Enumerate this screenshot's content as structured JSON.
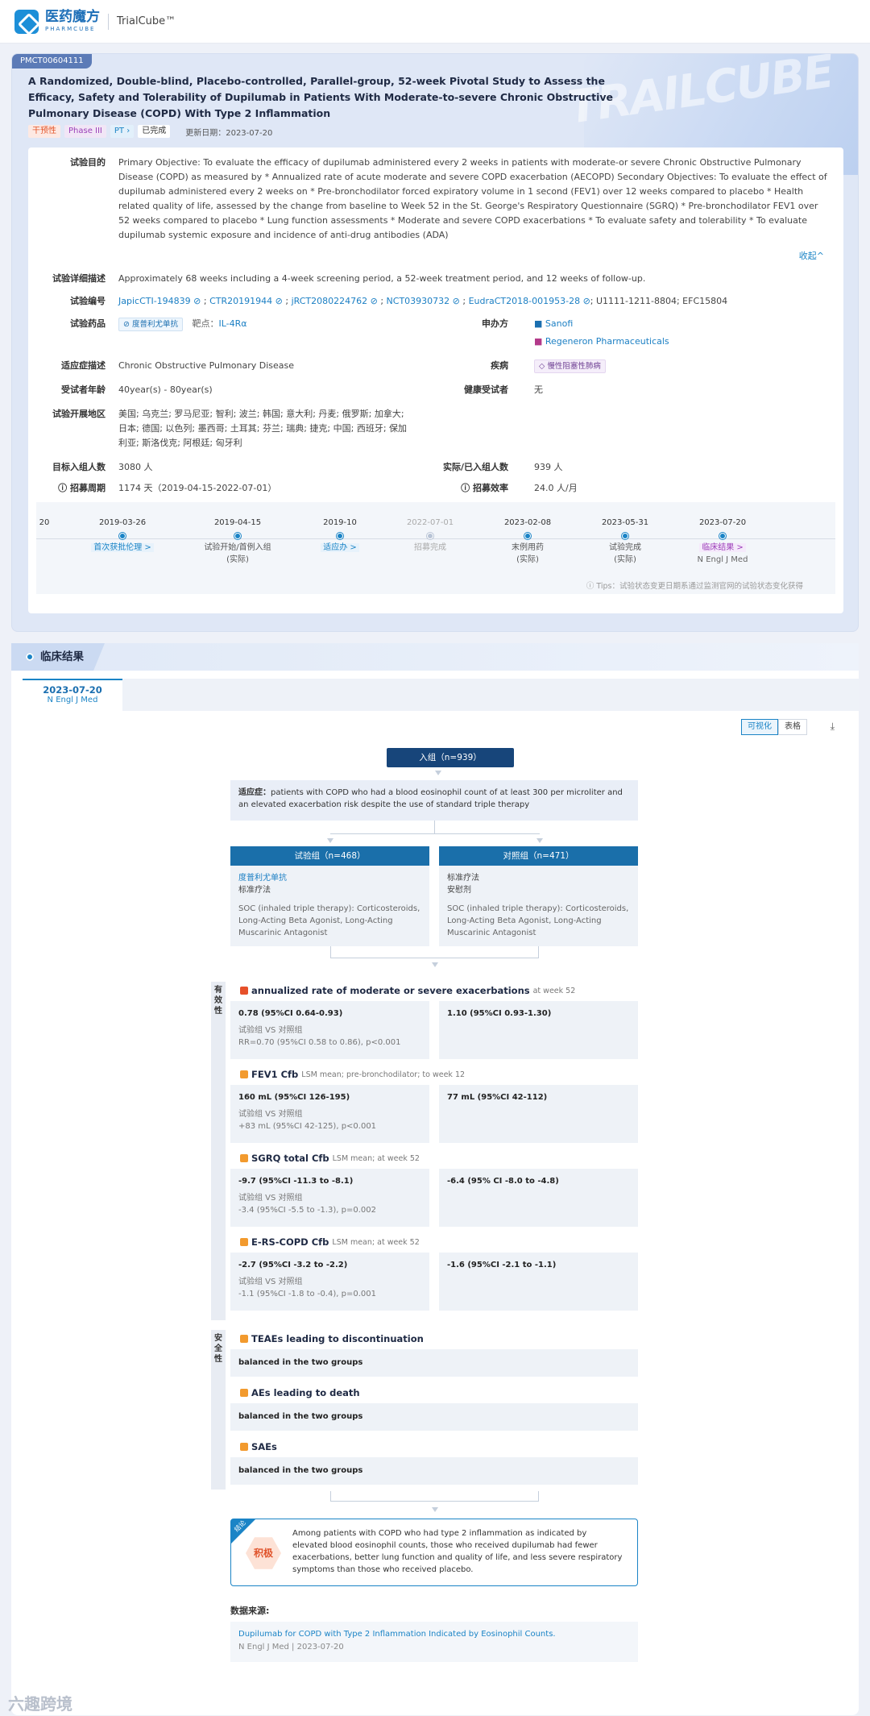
{
  "topbar": {
    "brand_cn": "医药魔方",
    "brand_en": "PHARMCUBE",
    "product": "TrialCube™"
  },
  "trial": {
    "id": "PMCT00604111",
    "title": "A Randomized, Double-blind, Placebo-controlled, Parallel-group, 52-week Pivotal Study to Assess the Efficacy, Safety and Tolerability of Dupilumab in Patients With Moderate-to-severe Chronic Obstructive Pulmonary Disease (COPD) With Type 2 Inflammation",
    "tags": [
      "干预性",
      "Phase III",
      "PT",
      "已完成"
    ],
    "updated_label": "更新日期：",
    "updated": "2023-07-20",
    "deco_text": "TRAILCUBE"
  },
  "fields": {
    "purpose_label": "试验目的",
    "purpose": "Primary Objective: To evaluate the efficacy of dupilumab administered every 2 weeks in patients with moderate-or severe Chronic Obstructive Pulmonary Disease (COPD) as measured by * Annualized rate of acute moderate and severe COPD exacerbation (AECOPD) Secondary Objectives: To evaluate the effect of dupilumab administered every 2 weeks on * Pre-bronchodilator forced expiratory volume in 1 second (FEV1) over 12 weeks compared to placebo * Health related quality of life, assessed by the change from baseline to Week 52 in the St. George's Respiratory Questionnaire (SGRQ) * Pre-bronchodilator FEV1 over 52 weeks compared to placebo * Lung function assessments * Moderate and severe COPD exacerbations * To evaluate safety and tolerability * To evaluate dupilumab systemic exposure and incidence of anti-drug antibodies (ADA)",
    "collapse": "收起^",
    "detail_label": "试验详细描述",
    "detail": "Approximately 68 weeks including a 4-week screening period, a 52-week treatment period, and 12 weeks of follow-up.",
    "ids_label": "试验编号",
    "ids": [
      "JapicCTI-194839",
      "CTR20191944",
      "jRCT2080224762",
      "NCT03930732",
      "EudraCT2018-001953-28"
    ],
    "ids_tail": "; U1111-1211-8804; EFC15804",
    "drug_label": "试验药品",
    "drug": "度普利尤单抗",
    "target_label": "靶点：",
    "target": "IL-4Rα",
    "sponsor_label": "申办方",
    "sponsors": [
      "Sanofi",
      "Regeneron Pharmaceuticals"
    ],
    "indication_label": "适应症描述",
    "indication": "Chronic Obstructive Pulmonary Disease",
    "disease_label": "疾病",
    "disease": "慢性阻塞性肺病",
    "age_label": "受试者年龄",
    "age": "40year(s) - 80year(s)",
    "healthy_label": "健康受试者",
    "healthy": "无",
    "region_label": "试验开展地区",
    "region": "美国; 乌克兰; 罗马尼亚; 智利; 波兰; 韩国; 意大利; 丹麦; 俄罗斯; 加拿大; 日本; 德国; 以色列; 墨西哥; 土耳其; 芬兰; 瑞典; 捷克; 中国; 西班牙; 保加利亚; 斯洛伐克; 阿根廷; 匈牙利",
    "target_enroll_label": "目标入组人数",
    "target_enroll": "3080 人",
    "actual_enroll_label": "实际/已入组人数",
    "actual_enroll": "939 人",
    "period_label": "招募周期",
    "period": "1174 天（2019-04-15-2022-07-01）",
    "efficiency_label": "招募效率",
    "efficiency": "24.0 人/月"
  },
  "timeline": {
    "edge_date": "20",
    "items": [
      {
        "date": "2019-03-26",
        "label": "首次获批伦理 >",
        "style": "link"
      },
      {
        "date": "2019-04-15",
        "label": "试验开始/首例入组",
        "sub": "(实际)",
        "style": "plain"
      },
      {
        "date": "2019-10",
        "label": "适应办 >",
        "style": "link"
      },
      {
        "date": "2022-07-01",
        "label": "招募完成",
        "style": "grey"
      },
      {
        "date": "2023-02-08",
        "label": "末例用药",
        "sub": "(实际)",
        "style": "plain"
      },
      {
        "date": "2023-05-31",
        "label": "试验完成",
        "sub": "(实际)",
        "style": "plain"
      },
      {
        "date": "2023-07-20",
        "label": "临床结果 >",
        "sub": "N Engl J Med",
        "style": "purple"
      }
    ],
    "tips": "ⓘ Tips：试验状态变更日期系通过监测官网的试验状态变化获得"
  },
  "results": {
    "section_title": "临床结果",
    "tab_date": "2023-07-20",
    "tab_journal": "N Engl J Med",
    "view_options": [
      "可视化",
      "表格"
    ],
    "download_icon": "download-icon",
    "enroll": "入组（n=939）",
    "indication_label": "适应症：",
    "indication": "patients with COPD who had a blood eosinophil count of at least 300 per microliter and an elevated exacerbation risk despite the use of standard triple therapy",
    "arms": [
      {
        "header": "试验组（n=468）",
        "drug": "度普利尤单抗",
        "std": "标准疗法",
        "soc": "SOC (inhaled triple therapy): Corticosteroids, Long-Acting Beta Agonist, Long-Acting Muscarinic Antagonist"
      },
      {
        "header": "对照组（n=471）",
        "drug": "标准疗法",
        "std": "安慰剂",
        "soc": "SOC (inhaled triple therapy): Corticosteroids, Long-Acting Beta Agonist, Long-Acting Muscarinic Antagonist"
      }
    ],
    "efficacy_label": "有效性",
    "efficacy": [
      {
        "name": "annualized rate of moderate or severe exacerbations",
        "note": "at week 52",
        "left": "0.78 (95%CI 0.64-0.93)",
        "vs": "试验组 VS 对照组",
        "stat": "RR=0.70 (95%CI 0.58 to 0.86), p<0.001",
        "right": "1.10 (95%CI 0.93-1.30)"
      },
      {
        "name": "FEV1 Cfb",
        "note": "LSM mean; pre-bronchodilator; to week 12",
        "left": "160 mL (95%CI 126-195)",
        "vs": "试验组 VS 对照组",
        "stat": "+83 mL (95%CI 42-125), p<0.001",
        "right": "77 mL (95%CI 42-112)"
      },
      {
        "name": "SGRQ total Cfb",
        "note": "LSM mean; at week 52",
        "left": "-9.7 (95%CI -11.3 to -8.1)",
        "vs": "试验组 VS 对照组",
        "stat": "-3.4 (95%CI -5.5 to -1.3), p=0.002",
        "right": "-6.4 (95% CI -8.0 to -4.8)"
      },
      {
        "name": "E-RS-COPD Cfb",
        "note": "LSM mean; at week 52",
        "left": "-2.7 (95%CI -3.2 to -2.2)",
        "vs": "试验组 VS 对照组",
        "stat": "-1.1 (95%CI -1.8 to -0.4), p=0.001",
        "right": "-1.6 (95%CI -2.1 to -1.1)"
      }
    ],
    "safety_label": "安全性",
    "safety": [
      {
        "name": "TEAEs leading to discontinuation",
        "value": "balanced in the two groups"
      },
      {
        "name": "AEs leading to death",
        "value": "balanced in the two groups"
      },
      {
        "name": "SAEs",
        "value": "balanced in the two groups"
      }
    ],
    "conclusion_corner": "结论",
    "conclusion_badge": "积极",
    "conclusion": "Among patients with COPD who had type 2 inflammation as indicated by elevated blood eosinophil counts, those who received dupilumab had fewer exacerbations, better lung function and quality of life, and less severe respiratory symptoms than those who received placebo.",
    "source_label": "数据来源:",
    "source_title": "Dupilumab for COPD with Type 2 Inflammation Indicated by Eosinophil Counts.",
    "source_meta": "N Engl J Med  |  2023-07-20"
  },
  "watermark": "六趣跨境"
}
